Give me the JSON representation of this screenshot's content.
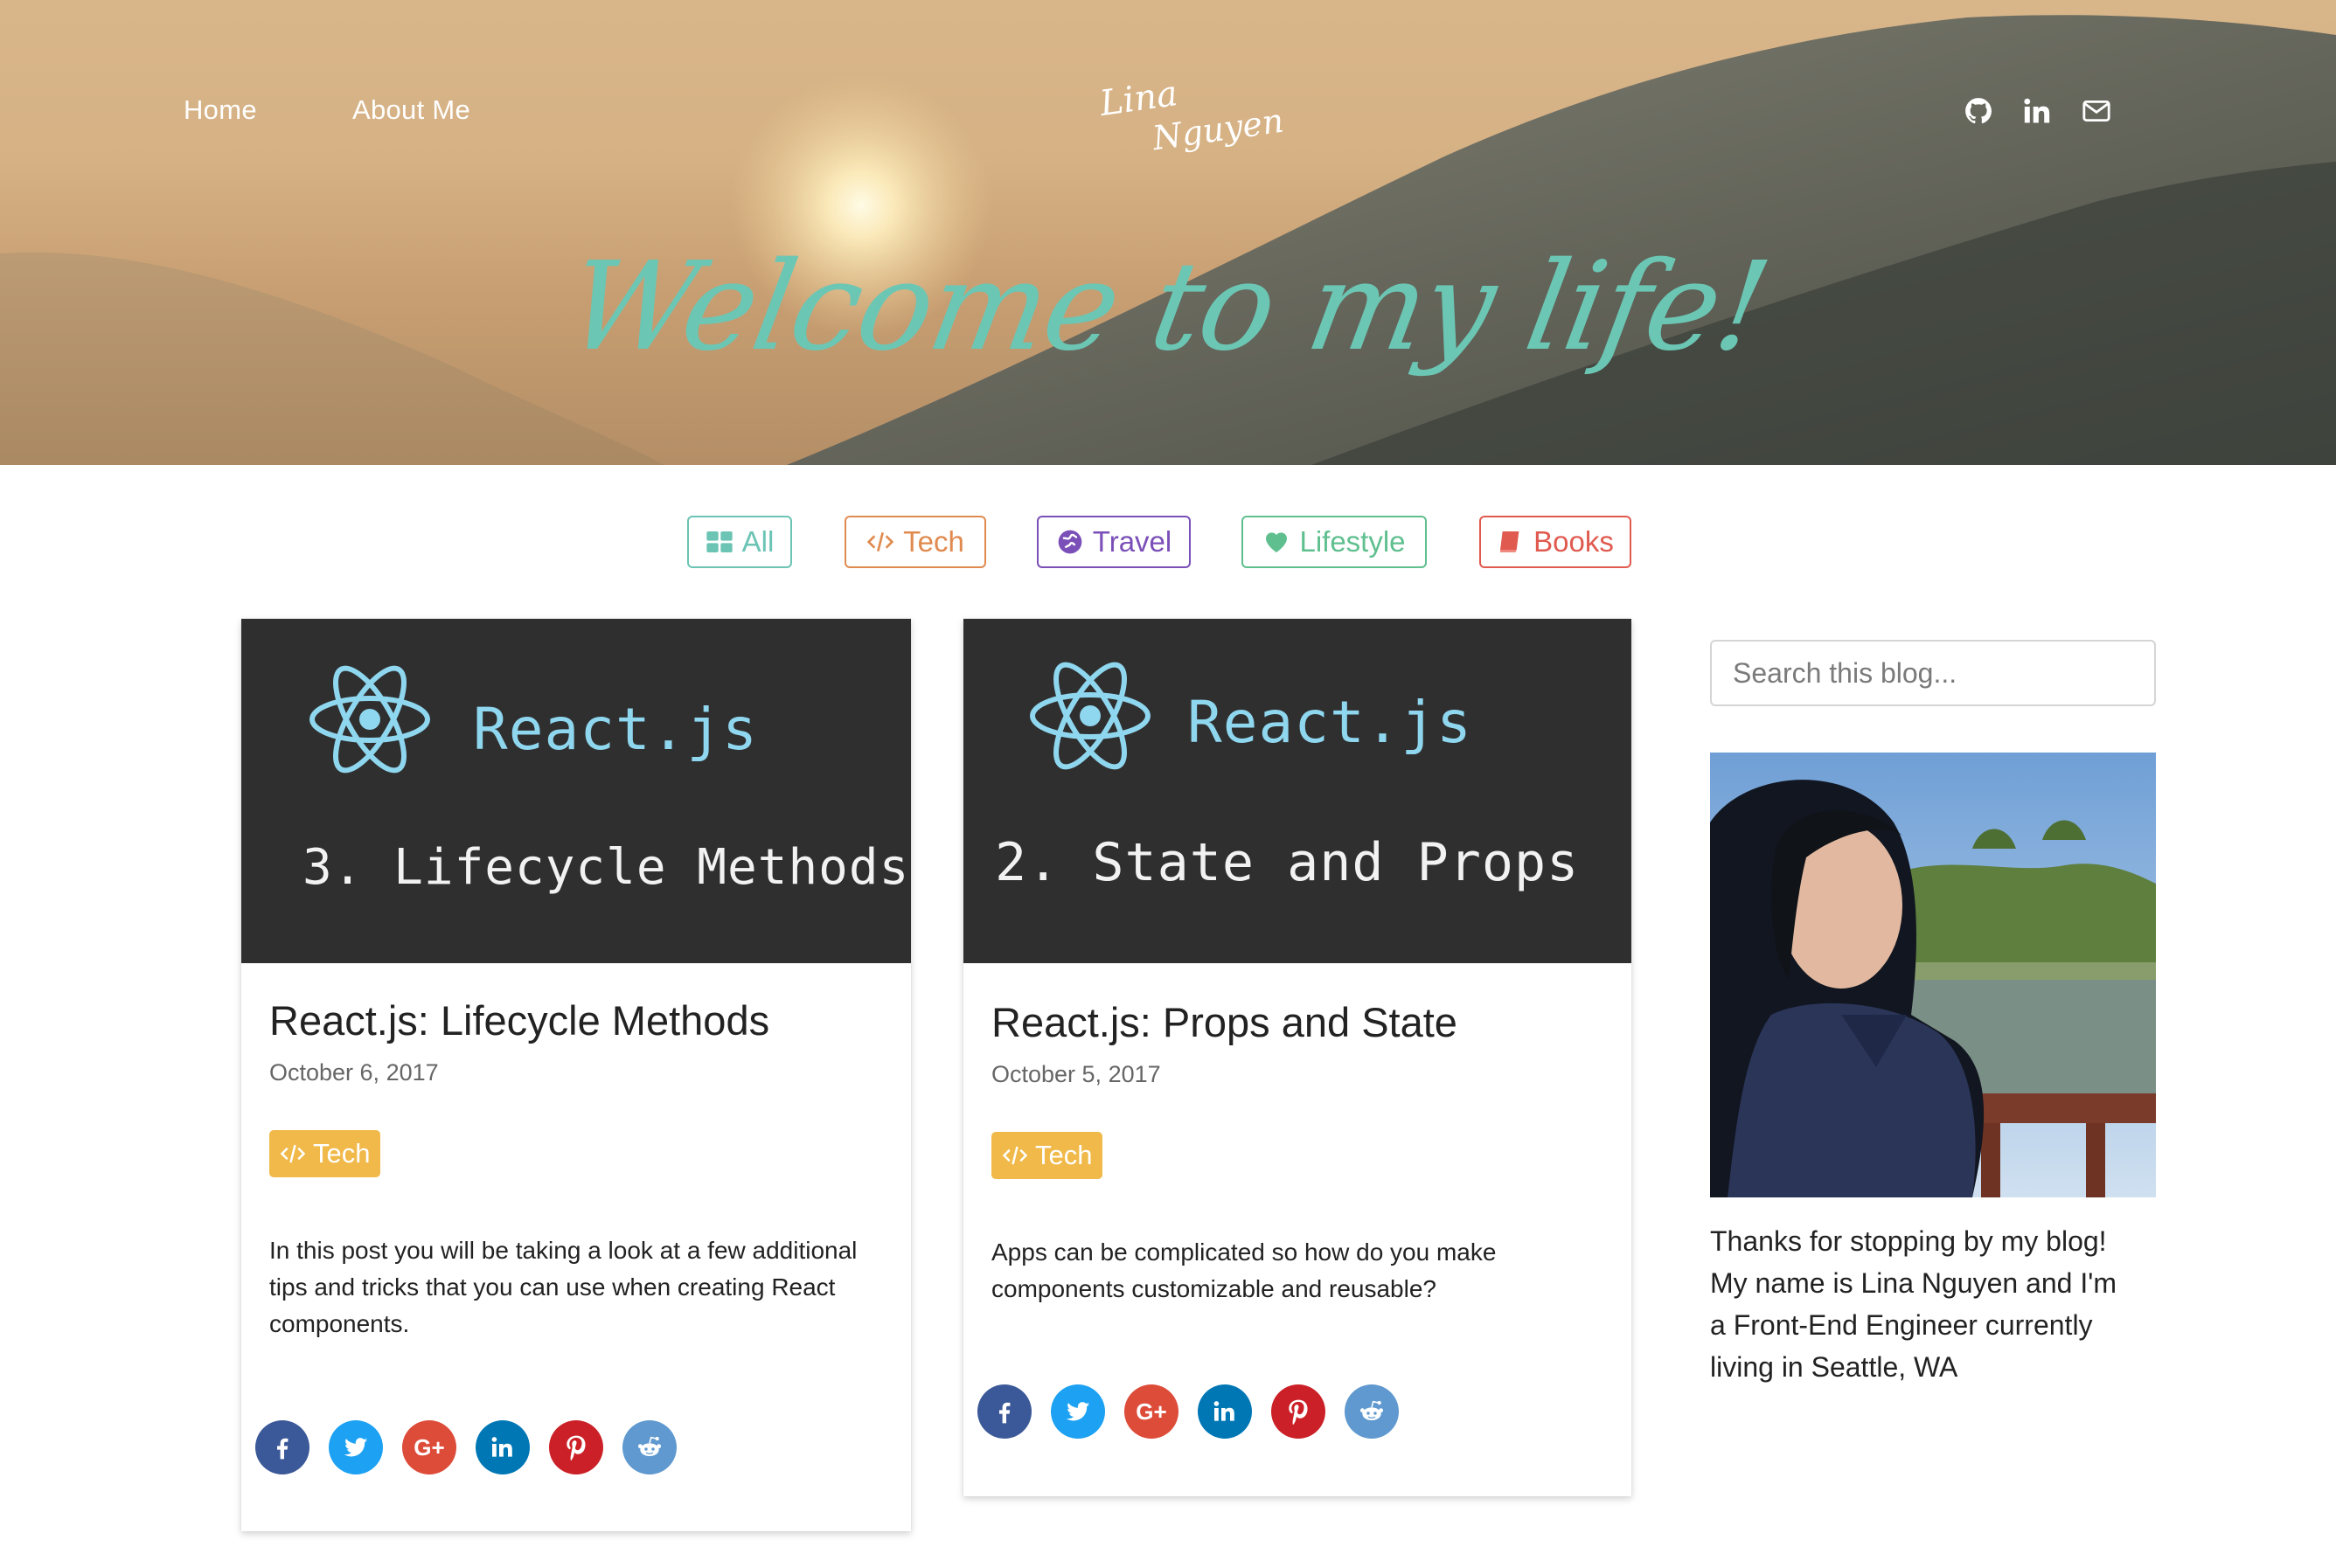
{
  "nav": {
    "home_label": "Home",
    "about_label": "About Me"
  },
  "logo": {
    "line1": "Lina",
    "line2": "Nguyen"
  },
  "social_top": [
    "github-icon",
    "linkedin-icon",
    "mail-icon"
  ],
  "hero": {
    "heading": "Welcome to my life!"
  },
  "filters": [
    {
      "label": "All",
      "icon": "grid-icon",
      "color": "#6bc4b4"
    },
    {
      "label": "Tech",
      "icon": "code-icon",
      "color": "#e08a4f"
    },
    {
      "label": "Travel",
      "icon": "globe-icon",
      "color": "#7a4fb8"
    },
    {
      "label": "Lifestyle",
      "icon": "heart-icon",
      "color": "#5fbf8f"
    },
    {
      "label": "Books",
      "icon": "book-icon",
      "color": "#e05a4f"
    }
  ],
  "posts": [
    {
      "image_title": "React.js",
      "image_subtitle": "3. Lifecycle Methods",
      "title": "React.js: Lifecycle Methods",
      "date": "October 6, 2017",
      "tag": "Tech",
      "description_lines": [
        "In this post you will be taking a look at a few additional",
        "tips and tricks that you can use when creating React",
        "components."
      ]
    },
    {
      "image_title": "React.js",
      "image_subtitle": "2. State and Props",
      "title": "React.js: Props and State",
      "date": "October 5, 2017",
      "tag": "Tech",
      "description_lines": [
        "Apps can be complicated so how do you make",
        "components customizable and reusable?"
      ]
    }
  ],
  "share_buttons": [
    {
      "name": "facebook",
      "color": "#3b5998",
      "glyph": "f"
    },
    {
      "name": "twitter",
      "color": "#1da1f2",
      "glyph": ""
    },
    {
      "name": "google-plus",
      "color": "#dd4b39",
      "glyph": "G+"
    },
    {
      "name": "linkedin",
      "color": "#0077b5",
      "glyph": "in"
    },
    {
      "name": "pinterest",
      "color": "#cb2027",
      "glyph": "P"
    },
    {
      "name": "reddit",
      "color": "#5f99cf",
      "glyph": ""
    }
  ],
  "sidebar": {
    "search_placeholder": "Search this blog...",
    "bio_lines": [
      "Thanks for stopping by my blog!",
      "My name is Lina Nguyen and I'm",
      "a Front-End Engineer currently",
      "living in Seattle, WA"
    ]
  },
  "colors": {
    "accent_teal": "#6cc6b4",
    "tag_tech": "#f0b94a",
    "card_image_bg": "#2f2f2f",
    "react_blue": "#8fd6ef"
  }
}
